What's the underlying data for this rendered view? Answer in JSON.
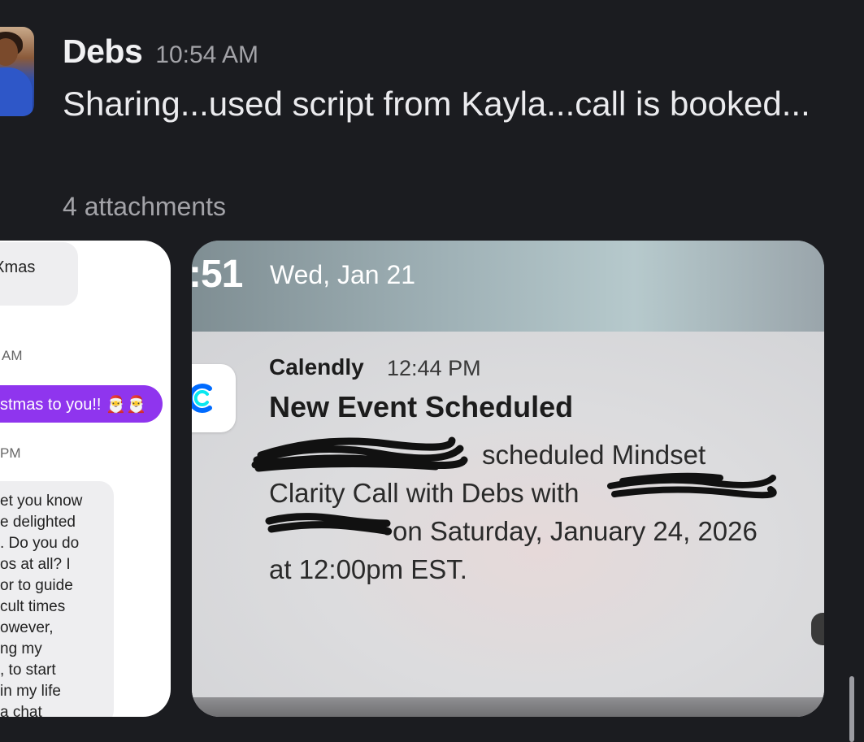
{
  "message": {
    "sender": "Debs",
    "time": "10:54 AM",
    "text": "Sharing...used script from Kayla...call is booked...",
    "attachments_label": "4 attachments"
  },
  "attachment_chat": {
    "bubble_1": "ry Xmas",
    "timestamp_1": "AM",
    "bubble_2": "stmas to you!! 🎅🎅",
    "timestamp_2": "PM",
    "bubble_3_lines": [
      "et you know",
      "e delighted",
      ". Do you do",
      "os at all? I",
      "or to guide",
      "cult times",
      "owever,",
      "ng my",
      ", to start",
      " in my life",
      " a chat"
    ]
  },
  "attachment_notification": {
    "clock": ":51",
    "date": "Wed, Jan 21",
    "app_name": "Calendly",
    "notification_time": "12:44 PM",
    "title": "New Event Scheduled",
    "body_line_1": "scheduled Mindset",
    "body_line_2": "Clarity Call with Debs with",
    "body_line_3": "on Saturday, January 24, 2026",
    "body_line_4": "at 12:00pm EST.",
    "app_icon": "calendly-icon",
    "bell_icon": "bell-icon"
  },
  "colors": {
    "background": "#1b1c20",
    "accent_purple": "#8f35ee",
    "calendly_blue": "#006bff"
  }
}
